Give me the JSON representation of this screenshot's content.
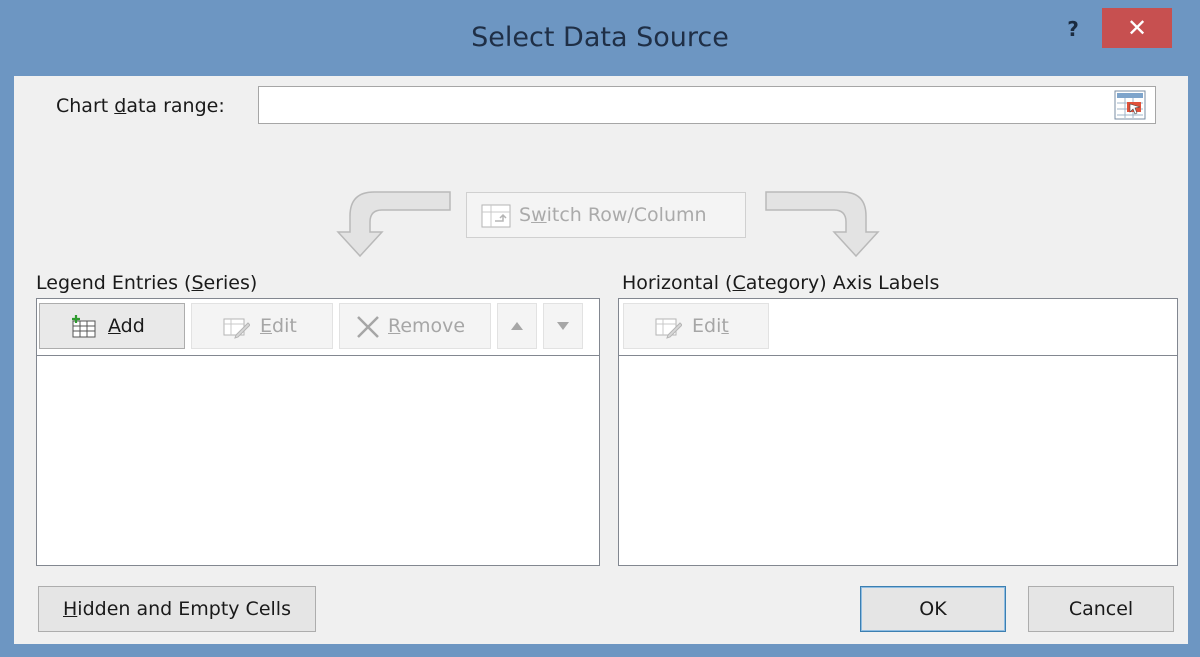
{
  "window": {
    "title": "Select Data Source",
    "help_label": "?",
    "close_label": "✕"
  },
  "range": {
    "label_prefix": "Chart ",
    "label_accel": "d",
    "label_suffix": "ata range:",
    "value": ""
  },
  "switch": {
    "label_prefix": "S",
    "label_accel": "w",
    "label_suffix": "itch Row/Column"
  },
  "legend": {
    "label_prefix": "Legend Entries (",
    "label_accel": "S",
    "label_suffix": "eries)",
    "add_accel": "A",
    "add_suffix": "dd",
    "edit_accel": "E",
    "edit_suffix": "dit",
    "remove_accel": "R",
    "remove_suffix": "emove",
    "items": []
  },
  "axis": {
    "label_prefix": "Horizontal (",
    "label_accel": "C",
    "label_suffix": "ategory) Axis Labels",
    "edit_prefix": "Edi",
    "edit_accel": "t",
    "items": []
  },
  "footer": {
    "hidden_accel": "H",
    "hidden_suffix": "idden and Empty Cells",
    "ok_label": "OK",
    "cancel_label": "Cancel"
  },
  "colors": {
    "frame": "#6d96c2",
    "close": "#c75050",
    "client": "#f0f0f0"
  }
}
